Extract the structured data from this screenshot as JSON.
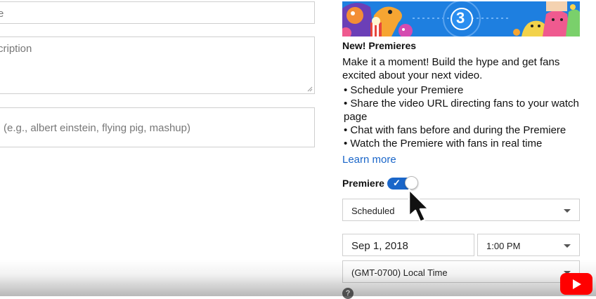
{
  "form": {
    "title_placeholder": "e",
    "description_placeholder": "cription",
    "tags_placeholder": "(e.g., albert einstein, flying pig, mashup)"
  },
  "banner": {
    "countdown_number": "3",
    "colors": {
      "background": "#1e7fe0"
    }
  },
  "premieres": {
    "heading": "New! Premieres",
    "description": "Make it a moment! Build the hype and get fans excited about your next video.",
    "bullets": [
      "• Schedule your Premiere",
      "• Share the video URL directing fans to your watch page",
      "• Chat with fans before and during the Premiere",
      "• Watch the Premiere with fans in real time"
    ],
    "learn_more": "Learn more",
    "toggle_label": "Premiere",
    "toggle_on": true,
    "schedule_select": "Scheduled",
    "date": "Sep 1, 2018",
    "time": "1:00 PM",
    "timezone": "(GMT-0700) Local Time",
    "help_glyph": "?"
  },
  "colors": {
    "accent": "#1a66c9",
    "youtube_red": "#ff0000"
  },
  "icons": {
    "toggle_check": "✓",
    "youtube": "youtube-logo-icon"
  }
}
